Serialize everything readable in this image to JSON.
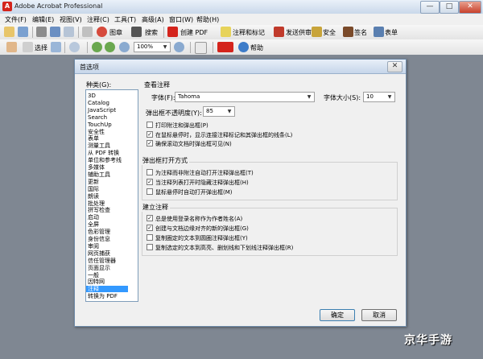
{
  "app": {
    "title": "Adobe Acrobat Professional",
    "icon_label": "A",
    "minimize": "—",
    "maximize": "□",
    "close": "✕"
  },
  "menu": [
    "文件(F)",
    "编辑(E)",
    "视图(V)",
    "注释(C)",
    "工具(T)",
    "高级(A)",
    "窗口(W)",
    "帮助(H)"
  ],
  "toolbar1": {
    "search_label": "搜索",
    "create_pdf": "创建 PDF",
    "comment_markup": "注释和标记",
    "send_review": "发送供审阅",
    "security": "安全",
    "sign": "签名",
    "forms": "表单"
  },
  "toolbar2": {
    "select_label": "选择",
    "zoom_value": "100%",
    "help_label": "帮助"
  },
  "dialog": {
    "title": "首选项",
    "close": "✕",
    "categories_label": "种类(G):",
    "categories": [
      "3D",
      "Catalog",
      "JavaScript",
      "Search",
      "TouchUp",
      "安全性",
      "表单",
      "测量工具",
      "从 PDF 转换",
      "单位和参考线",
      "多媒体",
      "辅助工具",
      "更新",
      "国际",
      "朗读",
      "批处理",
      "拼写检查",
      "启动",
      "全屏",
      "色彩管理",
      "身份信息",
      "审阅",
      "网页捕获",
      "信任管理器",
      "页面显示",
      "一般",
      "因特网",
      "注释",
      "转换为 PDF"
    ],
    "selected_category": "注释",
    "view_section": "查看注释",
    "font_label": "字体(F):",
    "font_value": "Tahoma",
    "font_size_label": "字体大小(S):",
    "font_size_value": "10",
    "opacity_label": "弹出框不透明度(Y):",
    "opacity_value": "85",
    "view_options": [
      {
        "label": "打印附注和弹出框(P)",
        "checked": false
      },
      {
        "label": "在鼠标悬停时，显示连接注释标记和其弹出框的线条(L)",
        "checked": true
      },
      {
        "label": "确保滚动文档时弹出框可见(N)",
        "checked": true
      }
    ],
    "popup_section": "弹出框打开方式",
    "popup_options": [
      {
        "label": "为注释而非附注自动打开注释弹出框(T)",
        "checked": false
      },
      {
        "label": "当注释列表打开时隐藏注释弹出框(H)",
        "checked": true
      },
      {
        "label": "鼠标悬停时自动打开弹出框(M)",
        "checked": false
      }
    ],
    "create_section": "建立注释",
    "create_options": [
      {
        "label": "总是使用登录名称作为作者姓名(A)",
        "checked": true
      },
      {
        "label": "创建与文档边缘对齐的新的弹出框(G)",
        "checked": true
      },
      {
        "label": "复制圈定的文本到圆圈注释弹出框(Y)",
        "checked": false
      },
      {
        "label": "复制选定的文本到高亮、删划线和下划线注释弹出框(R)",
        "checked": false
      }
    ],
    "ok": "确定",
    "cancel": "取消"
  },
  "watermark": "京华手游"
}
